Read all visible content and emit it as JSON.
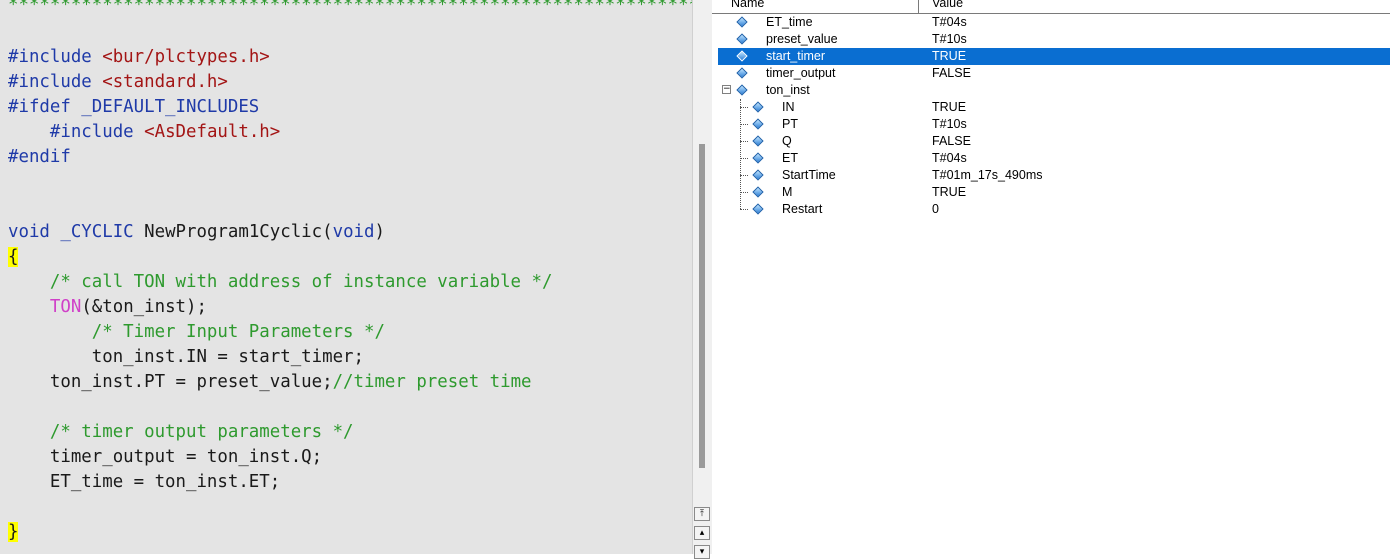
{
  "editor": {
    "separator": "************************************************************************",
    "lines": [
      {
        "parts": [
          {
            "t": "#include ",
            "c": "pre"
          },
          {
            "t": "<bur/plctypes.h>",
            "c": "str"
          }
        ]
      },
      {
        "parts": [
          {
            "t": "#include ",
            "c": "pre"
          },
          {
            "t": "<standard.h>",
            "c": "str"
          }
        ]
      },
      {
        "parts": [
          {
            "t": "#ifdef _DEFAULT_INCLUDES",
            "c": "pre"
          }
        ]
      },
      {
        "parts": [
          {
            "t": "    #include ",
            "c": "pre"
          },
          {
            "t": "<AsDefault.h>",
            "c": "str"
          }
        ]
      },
      {
        "parts": [
          {
            "t": "#endif",
            "c": "pre"
          }
        ]
      },
      {
        "parts": []
      },
      {
        "parts": []
      },
      {
        "parts": [
          {
            "t": "void",
            "c": "kw"
          },
          {
            "t": " _CYCLIC",
            "c": "kw"
          },
          {
            "t": " NewProgram1Cyclic(",
            "c": "tx"
          },
          {
            "t": "void",
            "c": "kw"
          },
          {
            "t": ")",
            "c": "tx"
          }
        ]
      },
      {
        "parts": [
          {
            "t": "{",
            "c": "brace"
          }
        ]
      },
      {
        "parts": [
          {
            "t": "    /* call TON with address of instance variable */",
            "c": "cm"
          }
        ]
      },
      {
        "parts": [
          {
            "t": "    ",
            "c": "tx"
          },
          {
            "t": "TON",
            "c": "fn"
          },
          {
            "t": "(&ton_inst);",
            "c": "tx"
          }
        ]
      },
      {
        "parts": [
          {
            "t": "        /* Timer Input Parameters */",
            "c": "cm"
          }
        ]
      },
      {
        "parts": [
          {
            "t": "        ton_inst.IN = start_timer;",
            "c": "tx"
          }
        ]
      },
      {
        "parts": [
          {
            "t": "    ton_inst.PT = preset_value;",
            "c": "tx"
          },
          {
            "t": "//timer preset time",
            "c": "cm"
          }
        ]
      },
      {
        "parts": []
      },
      {
        "parts": [
          {
            "t": "    /* timer output parameters */",
            "c": "cm"
          }
        ]
      },
      {
        "parts": [
          {
            "t": "    timer_output = ton_inst.Q;",
            "c": "tx"
          }
        ]
      },
      {
        "parts": [
          {
            "t": "    ET_time = ton_inst.ET;",
            "c": "tx"
          }
        ]
      },
      {
        "parts": []
      },
      {
        "parts": [
          {
            "t": "}",
            "c": "brace"
          }
        ]
      }
    ]
  },
  "scrollbar": {
    "buttons": [
      "⤒",
      "▴",
      "▾"
    ]
  },
  "watch": {
    "columns": {
      "name": "Name",
      "value": "Value"
    },
    "rows": [
      {
        "name": "ET_time",
        "value": "T#04s",
        "level": 0,
        "selected": false
      },
      {
        "name": "preset_value",
        "value": "T#10s",
        "level": 0,
        "selected": false
      },
      {
        "name": "start_timer",
        "value": "TRUE",
        "level": 0,
        "selected": true
      },
      {
        "name": "timer_output",
        "value": "FALSE",
        "level": 0,
        "selected": false
      },
      {
        "name": "ton_inst",
        "value": "",
        "level": 0,
        "selected": false,
        "expanded": true
      },
      {
        "name": "IN",
        "value": "TRUE",
        "level": 1,
        "selected": false
      },
      {
        "name": "PT",
        "value": "T#10s",
        "level": 1,
        "selected": false
      },
      {
        "name": "Q",
        "value": "FALSE",
        "level": 1,
        "selected": false
      },
      {
        "name": "ET",
        "value": "T#04s",
        "level": 1,
        "selected": false
      },
      {
        "name": "StartTime",
        "value": "T#01m_17s_490ms",
        "level": 1,
        "selected": false
      },
      {
        "name": "M",
        "value": "TRUE",
        "level": 1,
        "selected": false
      },
      {
        "name": "Restart",
        "value": "0",
        "level": 1,
        "selected": false
      }
    ],
    "expander_symbol": "−",
    "colors": {
      "selection": "#0a6ed1",
      "diamond": "#2f7fd6"
    }
  }
}
